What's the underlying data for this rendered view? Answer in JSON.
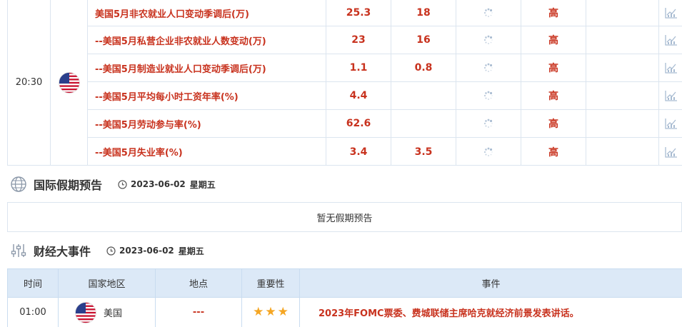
{
  "indicator_block": {
    "time": "20:30",
    "flag": "us-flag-icon",
    "rows": [
      {
        "name": "美国5月非农就业人口变动季调后(万)",
        "previous": "25.3",
        "expected": "18",
        "actual": "",
        "importance": "高"
      },
      {
        "name": "--美国5月私营企业非农就业人数变动(万)",
        "previous": "23",
        "expected": "16",
        "actual": "",
        "importance": "高"
      },
      {
        "name": "--美国5月制造业就业人口变动季调后(万)",
        "previous": "1.1",
        "expected": "0.8",
        "actual": "",
        "importance": "高"
      },
      {
        "name": "--美国5月平均每小时工资年率(%)",
        "previous": "4.4",
        "expected": "",
        "actual": "",
        "importance": "高"
      },
      {
        "name": "--美国5月劳动参与率(%)",
        "previous": "62.6",
        "expected": "",
        "actual": "",
        "importance": "高"
      },
      {
        "name": "--美国5月失业率(%)",
        "previous": "3.4",
        "expected": "3.5",
        "actual": "",
        "importance": "高"
      }
    ]
  },
  "holiday": {
    "title": "国际假期预告",
    "date": "2023-06-02",
    "weekday": "星期五",
    "empty_text": "暂无假期预告"
  },
  "events": {
    "title": "财经大事件",
    "date": "2023-06-02",
    "weekday": "星期五",
    "headers": {
      "time": "时间",
      "region": "国家地区",
      "location": "地点",
      "importance": "重要性",
      "event": "事件"
    },
    "rows": [
      {
        "time": "01:00",
        "region": "美国",
        "location": "---",
        "stars": 3,
        "event": "2023年FOMC票委、费城联储主席哈克就经济前景发表讲话。"
      }
    ]
  },
  "colors": {
    "accent_red": "#c8321e",
    "header_blue": "#dce9f7",
    "border": "#dce5ef",
    "star": "#f5a623"
  }
}
